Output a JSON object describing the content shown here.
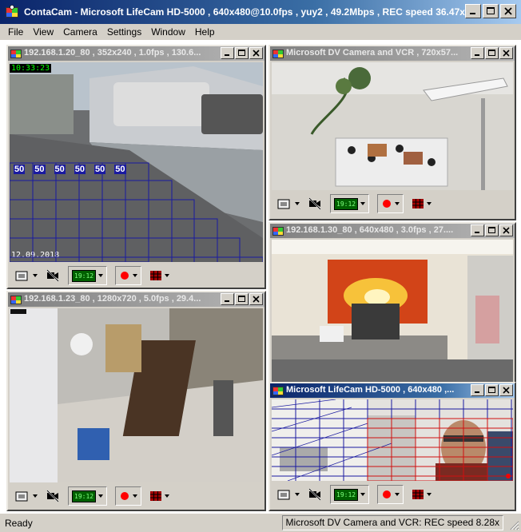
{
  "app": {
    "title": "ContaCam - Microsoft LifeCam HD-5000 , 640x480@10.0fps , yuy2 , 49.2Mbps , REC speed 36.47x"
  },
  "menu": [
    {
      "label": "File"
    },
    {
      "label": "View"
    },
    {
      "label": "Camera"
    },
    {
      "label": "Settings"
    },
    {
      "label": "Window"
    },
    {
      "label": "Help"
    }
  ],
  "windows": [
    {
      "title": "192.168.1.20_80 , 352x240 , 1.0fps , 130.6...",
      "osd_time": "10:33:23",
      "osd_date": "12.09.2018",
      "motion_value": "50",
      "active": false
    },
    {
      "title": "Microsoft DV Camera and VCR , 720x57...",
      "active": false
    },
    {
      "title": "192.168.1.30_80 , 640x480 , 3.0fps , 27....",
      "active": false
    },
    {
      "title": "192.168.1.23_80 , 1280x720 , 5.0fps , 29.4...",
      "active": false
    },
    {
      "title": "Microsoft LifeCam HD-5000 , 640x480 ,...",
      "active": true
    }
  ],
  "toolbar": {
    "clock_label": "19:12"
  },
  "status": {
    "left": "Ready",
    "right": "Microsoft DV Camera and VCR: REC speed 8.28x"
  },
  "colors": {
    "title_active": "#0a246a",
    "title_inactive": "#808080",
    "face": "#d4d0c8",
    "motion_grid": "#1a1aa0",
    "motion_detected": "#d01010",
    "rec_dot": "#ff0000"
  }
}
